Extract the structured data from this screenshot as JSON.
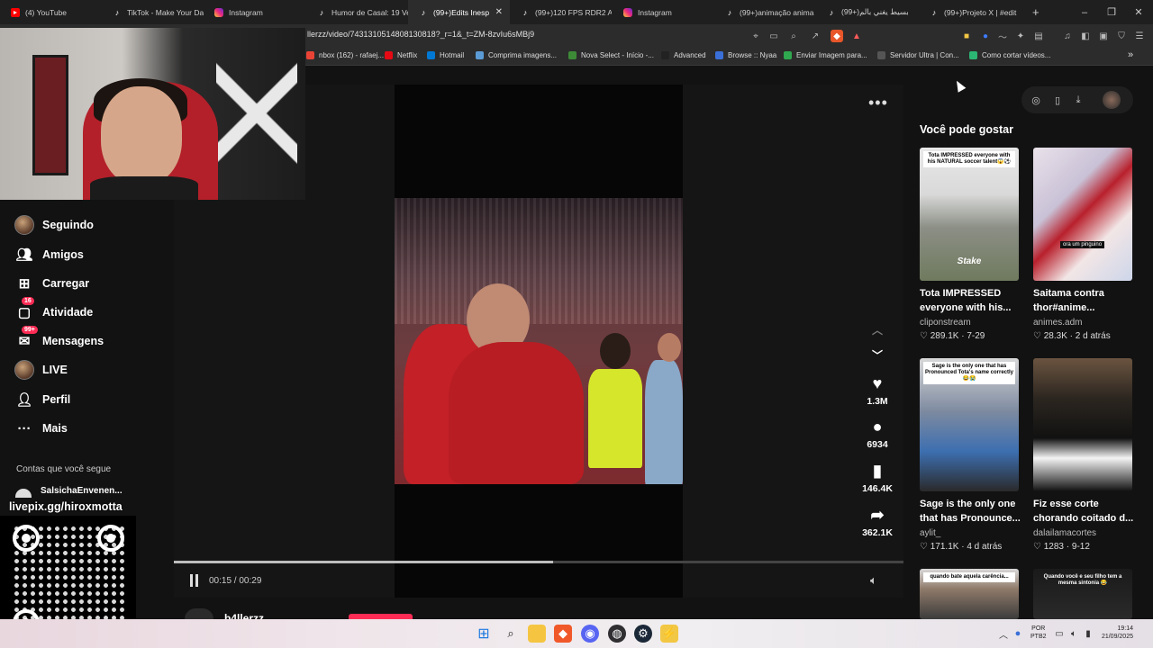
{
  "tabs": [
    {
      "label": "(4) YouTube",
      "icon": "youtube-icon"
    },
    {
      "label": "TikTok - Make Your Da",
      "icon": "tiktok-icon"
    },
    {
      "label": "Instagram",
      "icon": "instagram-icon"
    },
    {
      "label": "Humor de Casal: 19 Ve",
      "icon": "tiktok-icon"
    },
    {
      "label": "(99+)Edits Inesp",
      "icon": "tiktok-icon",
      "active": true
    },
    {
      "label": "(99+)120 FPS RDR2 A",
      "icon": "tiktok-icon"
    },
    {
      "label": "Instagram",
      "icon": "instagram-icon"
    },
    {
      "label": "(99+)animação anima",
      "icon": "tiktok-icon"
    },
    {
      "label": "(99+)بسيط يغني بالم",
      "icon": "tiktok-icon"
    },
    {
      "label": "(99+)Projeto X | #edit",
      "icon": "tiktok-icon"
    }
  ],
  "new_tab": "+",
  "window_controls": {
    "minimize": "–",
    "restore": "❐",
    "close": "✕"
  },
  "tab_close": "✕",
  "address": {
    "url": "llerzz/video/7431310514808130818?_r=1&_t=ZM-8zvIu6sMBj9"
  },
  "bookmarks": [
    {
      "label": "nbox (162) - rafaej...",
      "color": "#ea4335"
    },
    {
      "label": "Netflix",
      "color": "#e50914"
    },
    {
      "label": "Hotmail",
      "color": "#0078d4"
    },
    {
      "label": "Comprima imagens...",
      "color": "#5b9bd5"
    },
    {
      "label": "Nova Select - Início -...",
      "color": "#3d8b37"
    },
    {
      "label": "Advanced",
      "color": "#222222"
    },
    {
      "label": "Browse :: Nyaa",
      "color": "#3a6fd8"
    },
    {
      "label": "Enviar Imagem para...",
      "color": "#2fa84f"
    },
    {
      "label": "Servidor Ultra | Con...",
      "color": "#555555"
    },
    {
      "label": "Como cortar vídeos...",
      "color": "#2bb673"
    }
  ],
  "bookmarks_more": "»",
  "sidebar": {
    "items": [
      {
        "label": "Seguindo",
        "icon": "following-avatar-icon"
      },
      {
        "label": "Amigos",
        "icon": "friends-icon"
      },
      {
        "label": "Carregar",
        "icon": "upload-icon"
      },
      {
        "label": "Atividade",
        "icon": "activity-icon",
        "badge": "16"
      },
      {
        "label": "Mensagens",
        "icon": "messages-icon",
        "badge": "99+"
      },
      {
        "label": "LIVE",
        "icon": "live-avatar-icon"
      },
      {
        "label": "Perfil",
        "icon": "profile-icon"
      },
      {
        "label": "Mais",
        "icon": "more-icon"
      }
    ],
    "following_heading": "Contas que você segue",
    "following_first": "SalsichaEnvenen..."
  },
  "video": {
    "time": "00:15 / 00:29",
    "progress": 0.52,
    "likes": "1.3M",
    "comments": "6934",
    "saves": "146.4K",
    "shares": "362.1K",
    "author": "b4llerzz"
  },
  "recommend": {
    "title": "Você pode gostar",
    "cards": [
      {
        "title": "Tota IMPRESSED everyone with his...",
        "user": "cliponstream",
        "likes": "289.1K",
        "date": "7-29",
        "caption": "Tota IMPRESSED everyone with his NATURAL soccer talent😱⚽",
        "tag": "Stake"
      },
      {
        "title": "Saitama contra thor#anime...",
        "user": "animes.adm",
        "likes": "28.3K",
        "date": "2 d atrás",
        "tag": "ora um pinguino"
      },
      {
        "title": "Sage is the only one that has Pronounce...",
        "user": "aylit_",
        "likes": "171.1K",
        "date": "4 d atrás",
        "caption": "Sage is the only one that has Pronounced Tota's name correctly 😂😭"
      },
      {
        "title": "Fiz esse corte chorando coitado d...",
        "user": "dalailamacortes",
        "likes": "1283",
        "date": "9-12"
      },
      {
        "title": "",
        "user": "",
        "likes": "",
        "date": "",
        "caption": "quando bate aquela carência..."
      },
      {
        "title": "",
        "user": "",
        "likes": "",
        "date": "",
        "caption": "Quando você e seu filho tem a mesma sintonia 😂"
      }
    ]
  },
  "overlay": {
    "livepix": "livepix.gg/hiroxmotta"
  },
  "taskbar": {
    "lang": "POR\nPTB2",
    "time": "19:14",
    "date": "21/09/2025"
  }
}
